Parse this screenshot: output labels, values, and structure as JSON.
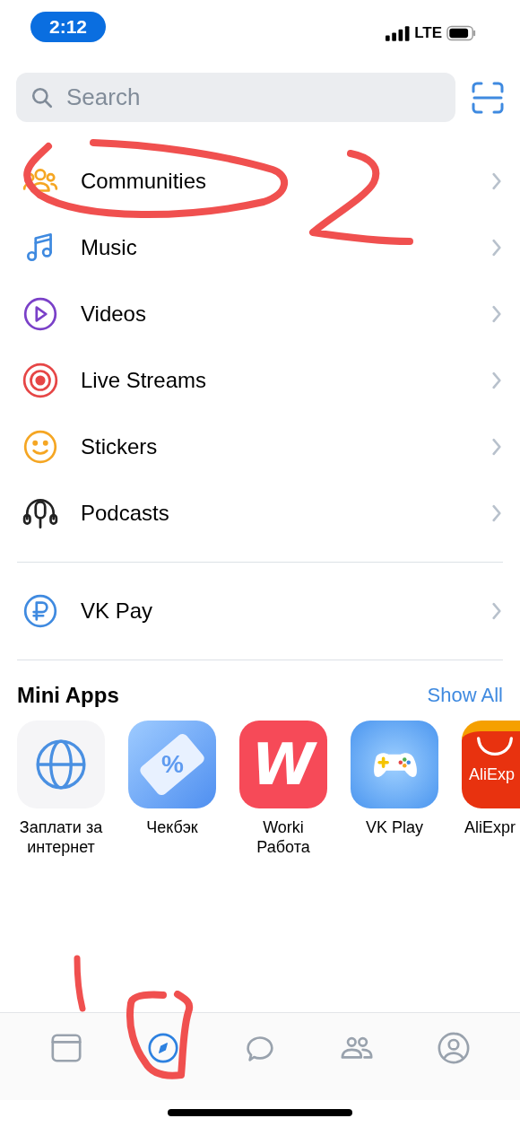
{
  "status_bar": {
    "time": "2:12",
    "network": "LTE"
  },
  "search": {
    "placeholder": "Search"
  },
  "menu": [
    {
      "kind": "people",
      "label": "Communities"
    },
    {
      "kind": "music",
      "label": "Music"
    },
    {
      "kind": "video",
      "label": "Videos"
    },
    {
      "kind": "live",
      "label": "Live Streams"
    },
    {
      "kind": "sticker",
      "label": "Stickers"
    },
    {
      "kind": "podcast",
      "label": "Podcasts"
    }
  ],
  "menu_2": [
    {
      "kind": "ruble",
      "label": "VK Pay"
    }
  ],
  "mini_apps": {
    "title": "Mini Apps",
    "link": "Show All",
    "apps": [
      {
        "kind": "globe",
        "name": "Заплати за интернет"
      },
      {
        "kind": "ticket",
        "name": "Чекбэк",
        "logo_text": "%"
      },
      {
        "kind": "worki",
        "name": "Worki Работа",
        "logo_text": "W"
      },
      {
        "kind": "gamepad",
        "name": "VK Play"
      },
      {
        "kind": "ali",
        "name": "AliExpr",
        "logo_text": "AliExp"
      }
    ]
  },
  "tab_bar": [
    {
      "kind": "news",
      "selected": false
    },
    {
      "kind": "explore",
      "selected": true
    },
    {
      "kind": "messages",
      "selected": false
    },
    {
      "kind": "friends",
      "selected": false
    },
    {
      "kind": "profile",
      "selected": false
    }
  ]
}
